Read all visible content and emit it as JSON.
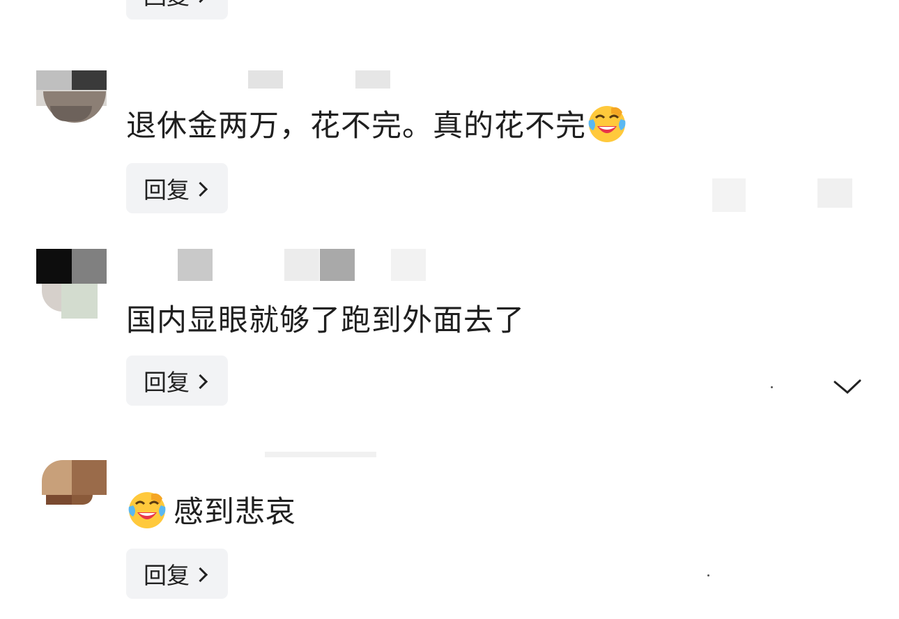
{
  "comments": [
    {
      "text": "退休金两万，花不完。真的花不完",
      "emoji_position": "after",
      "emoji": "laughing-crying-emoji",
      "reply_label": "回复"
    },
    {
      "text": "国内显眼就够了跑到外面去了",
      "reply_label": "回复"
    },
    {
      "text": "感到悲哀",
      "emoji_position": "before",
      "emoji": "laughing-crying-emoji",
      "reply_label": "回复"
    }
  ],
  "top_reply_label": "回复"
}
